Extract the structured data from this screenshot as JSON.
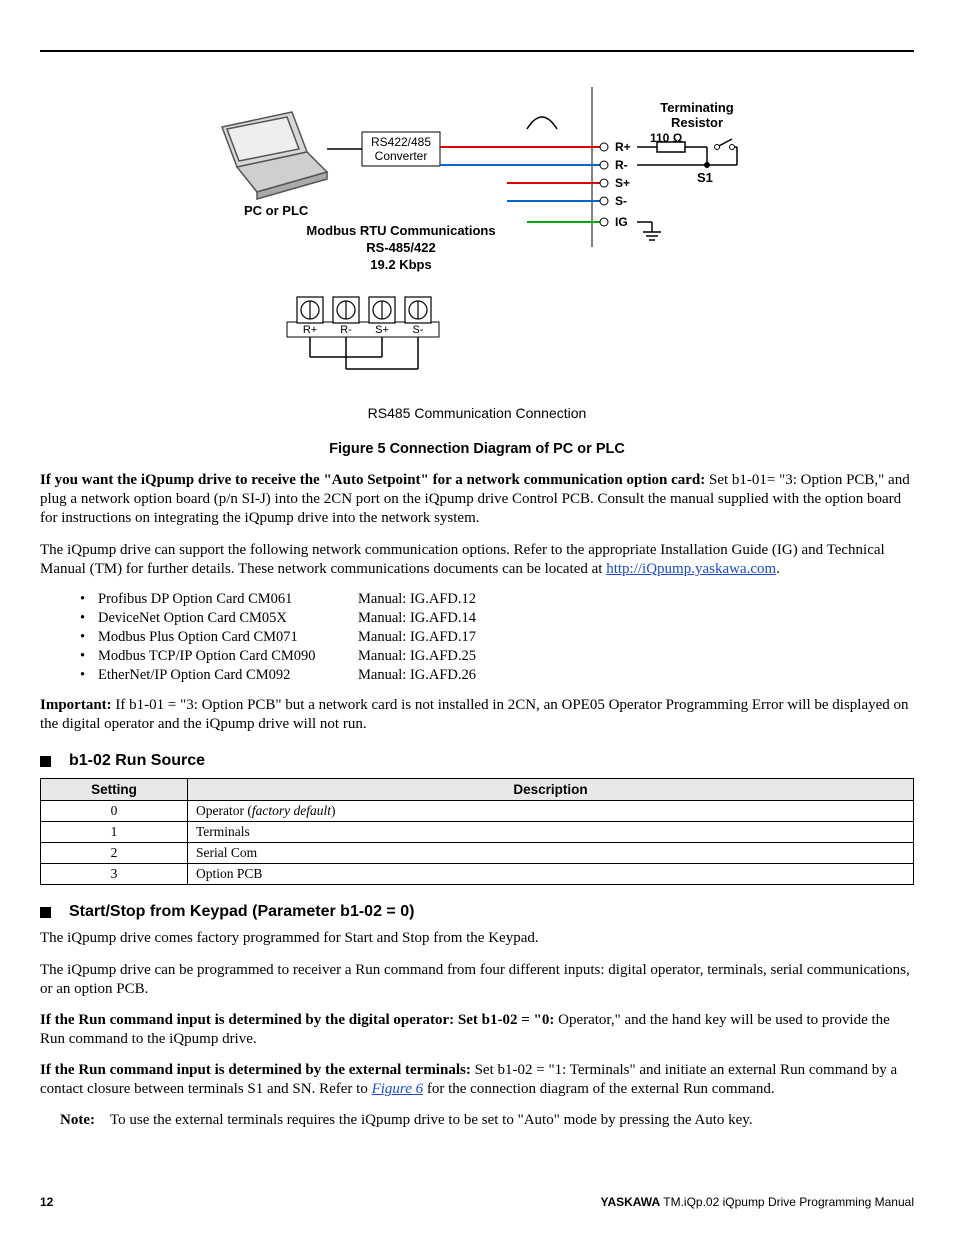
{
  "diagram": {
    "labels": {
      "pc_plc": "PC or PLC",
      "converter_line1": "RS422/485",
      "converter_line2": "Converter",
      "comm_line1": "Modbus RTU Communications",
      "comm_line2": "RS-485/422",
      "comm_line3": "19.2 Kbps",
      "term_res_line1": "Terminating",
      "term_res_line2": "Resistor",
      "ohm": "110 Ω",
      "s1_label": "S1",
      "r_plus": "R+",
      "r_minus": "R-",
      "s_plus": "S+",
      "s_minus": "S-",
      "ig": "IG",
      "conn_r_plus": "R+",
      "conn_r_minus": "R-",
      "conn_s_plus": "S+",
      "conn_s_minus": "S-"
    },
    "caption": "RS485 Communication Connection"
  },
  "figure_title": "Figure 5  Connection Diagram of PC or PLC",
  "p1_bold": "If you want the iQpump drive to receive the \"Auto Setpoint\" for a network communication option card:",
  "p1_rest": " Set b1-01= \"3: Option PCB,\" and plug a network option board (p/n SI-J) into the 2CN port on the iQpump drive Control PCB. Consult the manual supplied with the option board for instructions on integrating the iQpump drive into the network system.",
  "p2_a": "The iQpump drive can support the following network communication options. Refer to the appropriate Installation Guide (IG) and Technical Manual (TM) for further details. These network communications documents can be located at ",
  "p2_link": "http://iQpump.yaskawa.com",
  "p2_b": ".",
  "options": [
    {
      "name": "Profibus DP Option Card CM061",
      "manual": "Manual: IG.AFD.12"
    },
    {
      "name": "DeviceNet Option Card CM05X",
      "manual": "Manual: IG.AFD.14"
    },
    {
      "name": "Modbus Plus Option Card CM071",
      "manual": "Manual: IG.AFD.17"
    },
    {
      "name": "Modbus TCP/IP Option Card CM090",
      "manual": "Manual: IG.AFD.25"
    },
    {
      "name": "EtherNet/IP Option Card CM092",
      "manual": "Manual: IG.AFD.26"
    }
  ],
  "important_label": "Important:",
  "important_text": " If b1-01 = \"3: Option PCB\" but a network card is not installed in 2CN, an OPE05 Operator Programming Error will be displayed on the digital operator and the iQpump drive will not run.",
  "section_b102": "b1-02 Run Source",
  "table_headers": {
    "setting": "Setting",
    "description": "Description"
  },
  "table_rows": [
    {
      "setting": "0",
      "desc_a": "Operator (",
      "desc_italic": "factory default",
      "desc_b": ")"
    },
    {
      "setting": "1",
      "desc_a": "Terminals",
      "desc_italic": "",
      "desc_b": ""
    },
    {
      "setting": "2",
      "desc_a": "Serial Com",
      "desc_italic": "",
      "desc_b": ""
    },
    {
      "setting": "3",
      "desc_a": "Option PCB",
      "desc_italic": "",
      "desc_b": ""
    }
  ],
  "section_startstop": "Start/Stop from Keypad (Parameter b1-02 = 0)",
  "p3": "The iQpump drive comes factory programmed for Start and Stop from the Keypad.",
  "p4": "The iQpump drive can be programmed to receiver a Run command from four different inputs: digital operator, terminals, serial communications, or an option PCB.",
  "p5_bold": "If the Run command input is determined by the digital operator: Set b1-02 = \"0:",
  "p5_rest": " Operator,\" and the hand key will be used to provide the Run command to the iQpump drive.",
  "p6_bold": "If the Run command input is determined by the external terminals:",
  "p6_a": " Set b1-02 = \"1: Terminals\" and initiate an external Run command by a contact closure between terminals S1 and SN. Refer to ",
  "p6_link": "Figure 6",
  "p6_b": " for the connection diagram of the external Run command.",
  "note_label": "Note:",
  "note_text": "To use the external terminals requires the iQpump drive to be set to \"Auto\" mode by pressing the Auto key.",
  "footer": {
    "page": "12",
    "brand": "YASKAWA",
    "doc": "  TM.iQp.02 iQpump Drive Programming Manual"
  }
}
